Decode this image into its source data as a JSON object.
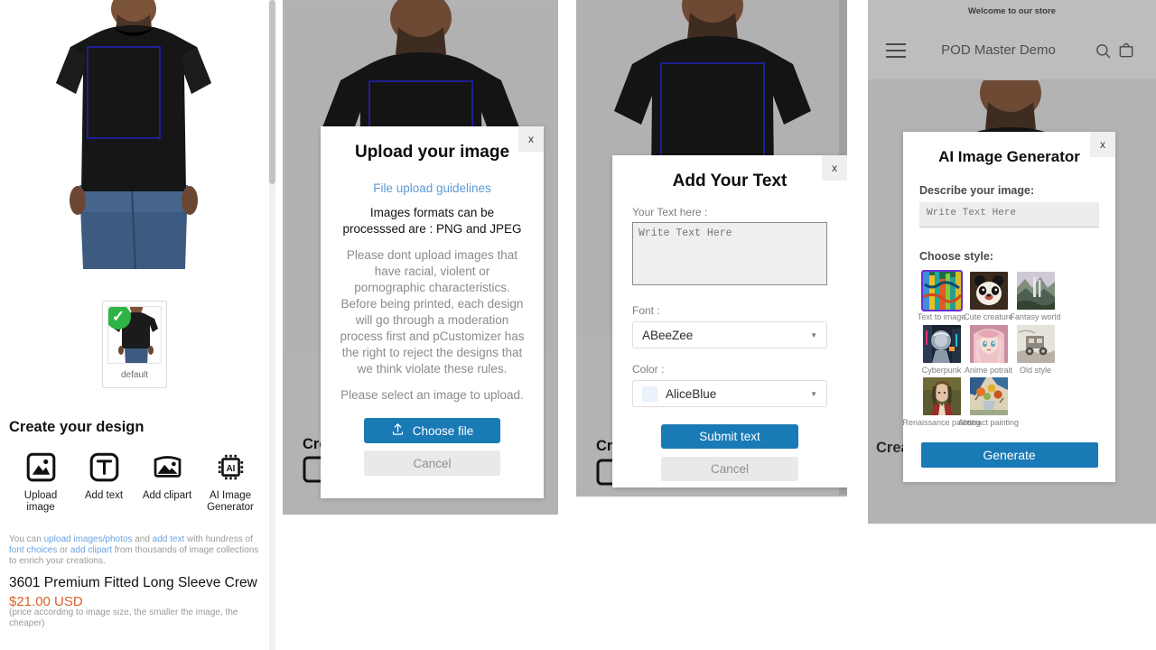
{
  "product_page": {
    "thumbnail_label": "default",
    "create_title": "Create your design",
    "tools": [
      {
        "label": "Upload image",
        "icon": "image-upload-icon"
      },
      {
        "label": "Add text",
        "icon": "text-box-icon"
      },
      {
        "label": "Add clipart",
        "icon": "clipart-icon"
      },
      {
        "label": "AI Image Generator",
        "icon": "ai-chip-icon"
      }
    ],
    "blurb": {
      "p1": "You can ",
      "link1": "upload images/photos",
      "p2": " and ",
      "link2": "add text",
      "p3": " with hundress of ",
      "link3": "font choices",
      "p4": " or ",
      "link4": "add clipart",
      "p5": " from thousands of image collections to enrich your creations."
    },
    "product_name": "3601 Premium Fitted Long Sleeve Crew",
    "price": "$21.00 USD",
    "price_note": "(price according to image size, the smaller the image, the cheaper)"
  },
  "upload_modal": {
    "close_label": "x",
    "title": "Upload your image",
    "guidelines_link": "File upload guidelines",
    "formats": "Images formats can be processsed are : PNG and JPEG",
    "rules": "Please dont upload images that have racial, violent or pornographic characteristics. Before being printed, each design will go through a moderation process first and pCustomizer has the right to reject the designs that we think violate these rules.",
    "select_prompt": "Please select an image to upload.",
    "choose_file_label": "Choose file",
    "choose_file_icon": "upload-arrow-icon",
    "cancel_label": "Cancel",
    "behind_heading": "Cre"
  },
  "text_modal": {
    "close_label": "x",
    "title": "Add Your Text",
    "text_label": "Your Text here :",
    "text_value": "",
    "text_placeholder": "Write Text Here",
    "font_label": "Font :",
    "font_value": "ABeeZee",
    "color_label": "Color :",
    "color_value": "AliceBlue",
    "color_swatch": "#eaf3fb",
    "submit_label": "Submit text",
    "cancel_label": "Cancel",
    "behind_heading": "Cre"
  },
  "storefront": {
    "announcement": "Welcome to our store",
    "brand": "POD Master Demo",
    "menu_icon": "hamburger-menu-icon",
    "search_icon": "search-icon",
    "cart_icon": "shopping-bag-icon",
    "behind_heading": "Create your design"
  },
  "ai_modal": {
    "close_label": "x",
    "title": "AI Image Generator",
    "describe_label": "Describe your image:",
    "prompt_value": "",
    "prompt_placeholder": "Write Text Here",
    "style_label": "Choose style:",
    "selected_style_index": 0,
    "selection_color": "#6a2fd4",
    "styles": [
      {
        "label": "Text to image"
      },
      {
        "label": "Cute creature"
      },
      {
        "label": "Fantasy world"
      },
      {
        "label": "Cyberpunk"
      },
      {
        "label": "Anime potrait"
      },
      {
        "label": "Old style"
      },
      {
        "label": "Renaissance painting"
      },
      {
        "label": "Abstract painting"
      }
    ],
    "generate_label": "Generate"
  },
  "theme": {
    "primary_button": "#1a7ab5",
    "price_color": "#d9622b",
    "link_color": "#5b9bd5",
    "check_green": "#2fb344",
    "print_area_outline": "#2222cc"
  }
}
